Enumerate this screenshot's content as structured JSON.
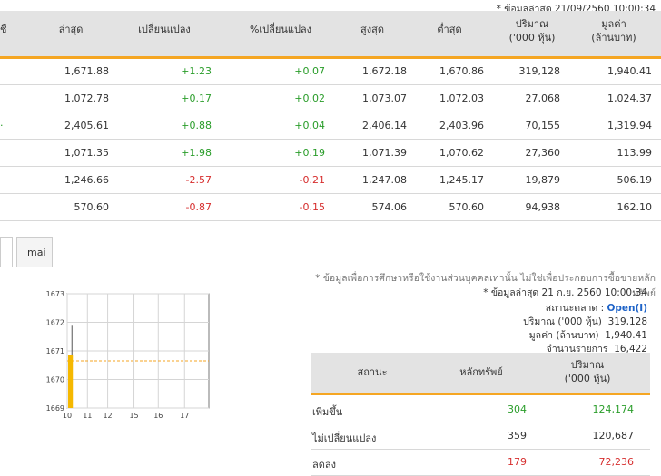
{
  "update_note": "* ข้อมูลล่าสุด 21/09/2560 10:00:34",
  "table": {
    "headers": [
      "ชื่",
      "ล่าสุด",
      "เปลี่ยนแปลง",
      "%เปลี่ยนแปลง",
      "สูงสุด",
      "ต่ำสุด",
      "ปริมาณ",
      "('000 หุ้น)",
      "มูลค่า",
      "(ล้านบาท)"
    ],
    "rows": [
      {
        "last": "1,671.88",
        "chg": "+1.23",
        "pct": "+0.07",
        "high": "1,672.18",
        "low": "1,670.86",
        "vol": "319,128",
        "val": "1,940.41",
        "dir": "up"
      },
      {
        "last": "1,072.78",
        "chg": "+0.17",
        "pct": "+0.02",
        "high": "1,073.07",
        "low": "1,072.03",
        "vol": "27,068",
        "val": "1,024.37",
        "dir": "up"
      },
      {
        "last": "2,405.61",
        "chg": "+0.88",
        "pct": "+0.04",
        "high": "2,406.14",
        "low": "2,403.96",
        "vol": "70,155",
        "val": "1,319.94",
        "dir": "up"
      },
      {
        "last": "1,071.35",
        "chg": "+1.98",
        "pct": "+0.19",
        "high": "1,071.39",
        "low": "1,070.62",
        "vol": "27,360",
        "val": "113.99",
        "dir": "up"
      },
      {
        "last": "1,246.66",
        "chg": "-2.57",
        "pct": "-0.21",
        "high": "1,247.08",
        "low": "1,245.17",
        "vol": "19,879",
        "val": "506.19",
        "dir": "down"
      },
      {
        "last": "570.60",
        "chg": "-0.87",
        "pct": "-0.15",
        "high": "574.06",
        "low": "570.60",
        "vol": "94,938",
        "val": "162.10",
        "dir": "down"
      }
    ]
  },
  "tabs": [
    "mai"
  ],
  "info": {
    "disclaimer": "* ข้อมูลเพื่อการศึกษาหรือใช้งานส่วนบุคคลเท่านั้น ไม่ใช่เพื่อประกอบการซื้อขายหลักทรัพย์",
    "updated": "* ข้อมูลล่าสุด 21 ก.ย. 2560 10:00:34",
    "market_label": "สถานะตลาด :",
    "market_status": "Open(I)",
    "volume_label": "ปริมาณ ('000 หุ้น)",
    "volume": "319,128",
    "value_label": "มูลค่า (ล้านบาท)",
    "value": "1,940.41",
    "trades_label": "จำนวนรายการ",
    "trades": "16,422"
  },
  "summary": {
    "headers": [
      "สถานะ",
      "หลักทรัพย์",
      "ปริมาณ",
      "('000 หุ้น)"
    ],
    "rows": [
      {
        "label": "เพิ่มขึ้น",
        "count": "304",
        "vol": "124,174",
        "dir": "up"
      },
      {
        "label": "ไม่เปลี่ยนแปลง",
        "count": "359",
        "vol": "120,687",
        "dir": "flat"
      },
      {
        "label": "ลดลง",
        "count": "179",
        "vol": "72,236",
        "dir": "down"
      }
    ]
  },
  "chart_data": {
    "type": "line",
    "x_ticks": [
      "10",
      "11",
      "12",
      "15",
      "16",
      "17"
    ],
    "y_ticks": [
      "1673",
      "1672",
      "1671",
      "1670",
      "1669"
    ],
    "ylim": [
      1669,
      1673
    ],
    "reference_line": 1670.65,
    "series": [
      {
        "x": [
          10,
          10.1
        ],
        "values": [
          1670.86,
          1671.88
        ]
      }
    ],
    "colors": {
      "fill": "#f5b800",
      "reference": "#f5a623",
      "line": "#555555"
    }
  }
}
